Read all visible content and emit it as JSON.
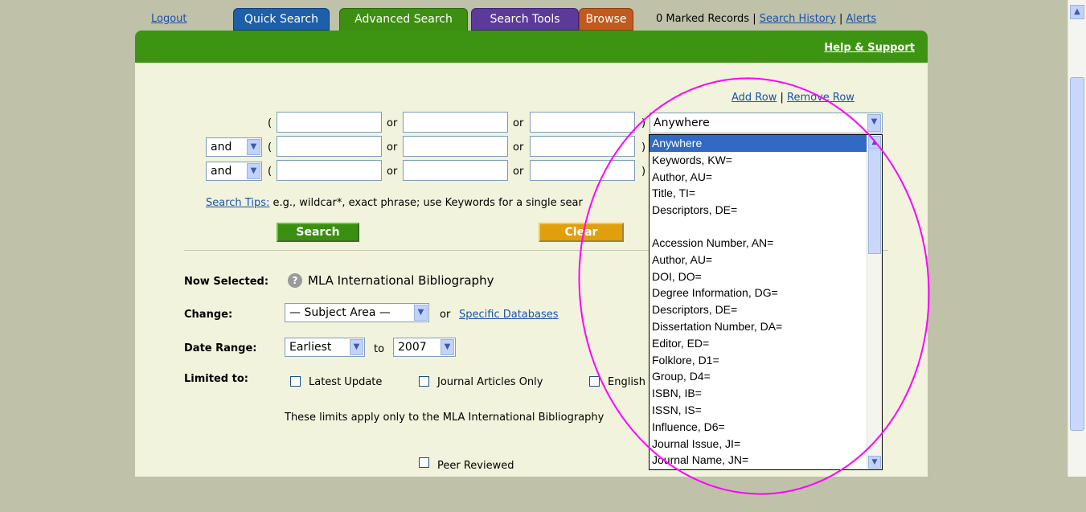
{
  "top": {
    "logout": "Logout",
    "tabs": [
      "Quick Search",
      "Advanced Search",
      "Search Tools",
      "Browse"
    ],
    "marked_records": "0 Marked Records",
    "search_history": "Search History",
    "alerts": "Alerts",
    "sep": "|"
  },
  "header": {
    "help": "Help & Support"
  },
  "rows": {
    "add_row": "Add Row",
    "remove_row": "Remove Row",
    "sep": "|",
    "or_label": "or",
    "open_paren": "(",
    "close_paren": ")",
    "bool_values": [
      "and",
      "and"
    ]
  },
  "field_select": {
    "value": "Anywhere"
  },
  "search_tips": {
    "link": "Search Tips:",
    "text": " e.g., wildcar*, exact phrase; use Keywords for a single sear"
  },
  "buttons": {
    "search": "Search",
    "clear": "Clear"
  },
  "selected": {
    "label": "Now Selected:",
    "value": "MLA International Bibliography"
  },
  "change": {
    "label": "Change:",
    "subject_area": "— Subject Area —",
    "or": "or",
    "specific": "Specific Databases"
  },
  "date_range": {
    "label": "Date Range:",
    "from": "Earliest",
    "to_label": "to",
    "to": "2007"
  },
  "limits": {
    "label": "Limited to:",
    "latest": "Latest Update",
    "journal": "Journal Articles Only",
    "english": "English",
    "note": "These limits apply only to the MLA International Bibliography",
    "peer": "Peer Reviewed"
  },
  "dropdown_options": [
    "Anywhere",
    "Keywords, KW=",
    "Author, AU=",
    "Title, TI=",
    "Descriptors, DE=",
    "",
    "Accession Number, AN=",
    "Author, AU=",
    "DOI, DO=",
    "Degree Information, DG=",
    "Descriptors, DE=",
    "Dissertation Number, DA=",
    "Editor, ED=",
    "Folklore, D1=",
    "Group, D4=",
    "ISBN, IB=",
    "ISSN, IS=",
    "Influence, D6=",
    "Journal Issue, JI=",
    "Journal Name, JN="
  ],
  "colors": {
    "tab_quick": "#1d5fa8",
    "tab_advanced": "#3d8f12",
    "tab_tools": "#5b3a9a",
    "tab_browse": "#c05b1d",
    "highlight": "#ff00ff",
    "selection": "#316ac5"
  }
}
